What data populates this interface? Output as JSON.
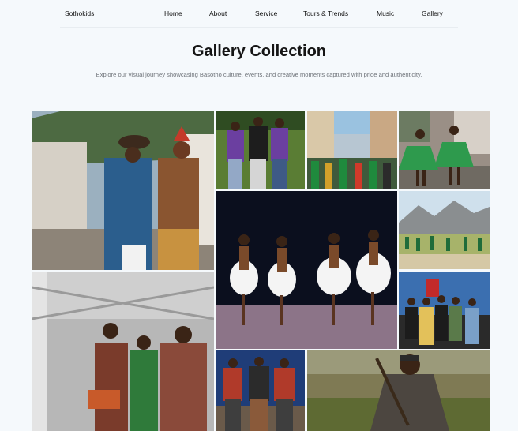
{
  "nav": {
    "brand": "Sothokids",
    "links": [
      "Home",
      "About",
      "Service",
      "Tours & Trends",
      "Music",
      "Gallery"
    ]
  },
  "page": {
    "title": "Gallery Collection",
    "subtitle": "Explore our visual journey showcasing Basotho culture, events, and creative moments captured with pride and authenticity."
  },
  "gallery": {
    "photos": [
      "two-men-in-traditional-dress-shaking-hands",
      "three-people-with-lanyards-on-grass",
      "crowd-in-city-street-festival",
      "dancers-in-green-costumes-outdoors",
      "mountain-field-dance-group",
      "stage-dancers-with-feather-skirts",
      "musicians-on-outdoor-stage",
      "group-in-blankets-indoors",
      "three-men-in-red-patterned-shirts",
      "man-in-blanket-holding-stick"
    ]
  }
}
